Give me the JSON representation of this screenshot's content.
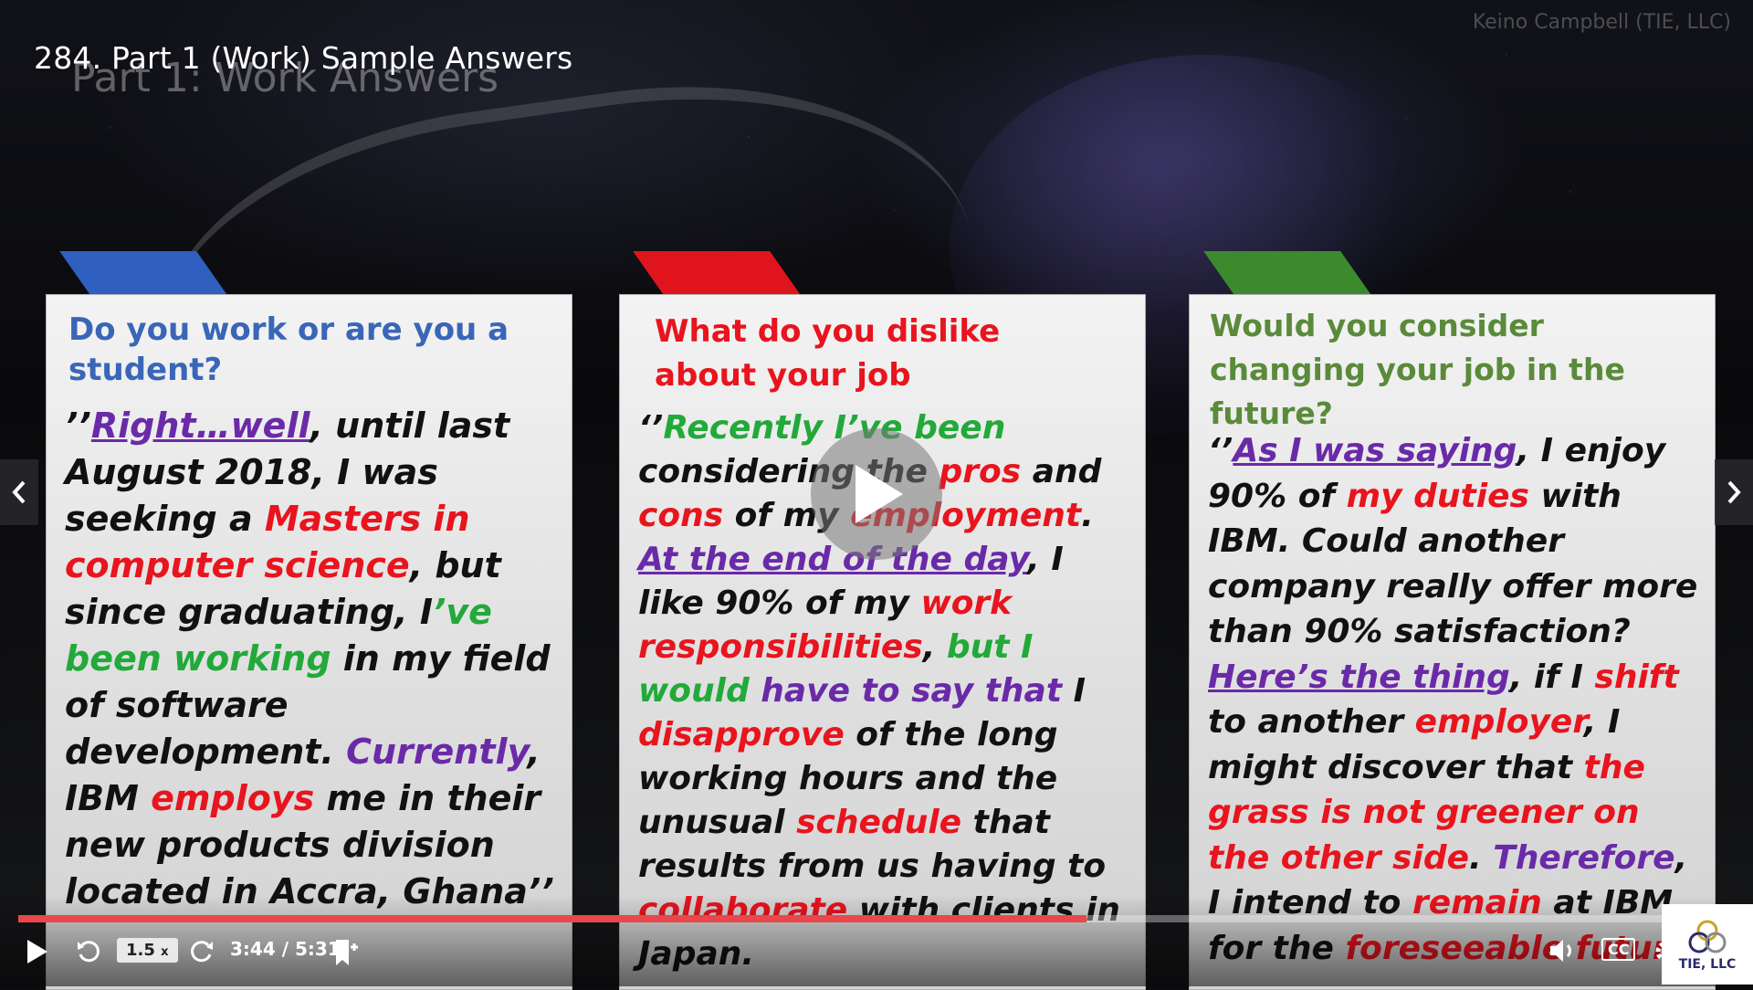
{
  "video": {
    "title": "284. Part 1 (Work) Sample Answers",
    "slide_heading": "Part 1: Work Answers",
    "watermark": "Keino Campbell (TIE, LLC)"
  },
  "cards": [
    {
      "tab_color": "#2f5fbf",
      "question_color": "#3a66b8",
      "question": "Do you work or are you a student?",
      "answer": [
        {
          "t": "’’",
          "c": ""
        },
        {
          "t": "Right…well",
          "c": "purple ul"
        },
        {
          "t": ", until last August 2018, I was seeking a ",
          "c": ""
        },
        {
          "t": "Masters in computer science",
          "c": "red"
        },
        {
          "t": ", but since graduating, I",
          "c": ""
        },
        {
          "t": "’ve been working",
          "c": "green"
        },
        {
          "t": " in my field of software development. ",
          "c": ""
        },
        {
          "t": "Currently",
          "c": "purple"
        },
        {
          "t": ", IBM ",
          "c": ""
        },
        {
          "t": "employs",
          "c": "red"
        },
        {
          "t": " me in their new products division located in Accra, Ghana’’",
          "c": ""
        }
      ]
    },
    {
      "tab_color": "#e0141c",
      "question_color": "#e8141e",
      "question": "What do you dislike about your job",
      "answer": [
        {
          "t": "‘’",
          "c": ""
        },
        {
          "t": "Recently I’ve been",
          "c": "green"
        },
        {
          "t": " considering the ",
          "c": ""
        },
        {
          "t": "pros",
          "c": "red"
        },
        {
          "t": " and ",
          "c": ""
        },
        {
          "t": "cons",
          "c": "red"
        },
        {
          "t": " of my ",
          "c": ""
        },
        {
          "t": "employment",
          "c": "red"
        },
        {
          "t": ". ",
          "c": ""
        },
        {
          "t": "At the end of the day",
          "c": "purple ul"
        },
        {
          "t": ", I like 90% of my ",
          "c": ""
        },
        {
          "t": "work responsibilities",
          "c": "red"
        },
        {
          "t": ",  ",
          "c": ""
        },
        {
          "t": "but I would",
          "c": "green"
        },
        {
          "t": " ",
          "c": ""
        },
        {
          "t": "have to say that",
          "c": "purple"
        },
        {
          "t": " I ",
          "c": ""
        },
        {
          "t": "disapprove",
          "c": "red"
        },
        {
          "t": " of the long working hours and the unusual ",
          "c": ""
        },
        {
          "t": "schedule",
          "c": "red"
        },
        {
          "t": " that results from us having to ",
          "c": ""
        },
        {
          "t": "collaborate",
          "c": "red"
        },
        {
          "t": " with clients in Japan.",
          "c": ""
        }
      ]
    },
    {
      "tab_color": "#3c8a2e",
      "question_color": "#5a8a3a",
      "question": "Would you consider changing your job in the future?",
      "answer": [
        {
          "t": "‘’",
          "c": ""
        },
        {
          "t": "As I was saying",
          "c": "purple ul"
        },
        {
          "t": ", I enjoy 90% of ",
          "c": ""
        },
        {
          "t": "my duties",
          "c": "red"
        },
        {
          "t": " with IBM. Could another company really offer more than 90% satisfaction? ",
          "c": ""
        },
        {
          "t": "Here’s the thing",
          "c": "purple ul"
        },
        {
          "t": ", if I ",
          "c": ""
        },
        {
          "t": "shift",
          "c": "red"
        },
        {
          "t": " to another ",
          "c": ""
        },
        {
          "t": "employer",
          "c": "red"
        },
        {
          "t": ", I might discover that ",
          "c": ""
        },
        {
          "t": "the grass is not greener on the other side",
          "c": "red"
        },
        {
          "t": ". ",
          "c": ""
        },
        {
          "t": "Therefore",
          "c": "purple"
        },
        {
          "t": ", I intend to ",
          "c": ""
        },
        {
          "t": "remain",
          "c": "red"
        },
        {
          "t": " at IBM for the ",
          "c": ""
        },
        {
          "t": "foreseeable future",
          "c": "red"
        },
        {
          "t": ".",
          "c": ""
        }
      ]
    }
  ],
  "player": {
    "progress": 0.65,
    "speed_label": "1.5",
    "speed_suffix": "x",
    "time": "3:44 / 5:31",
    "cc_label": "CC",
    "logo_text": "TIE, LLC",
    "prev_icon": "chevron-left-icon",
    "next_icon": "chevron-right-icon"
  }
}
